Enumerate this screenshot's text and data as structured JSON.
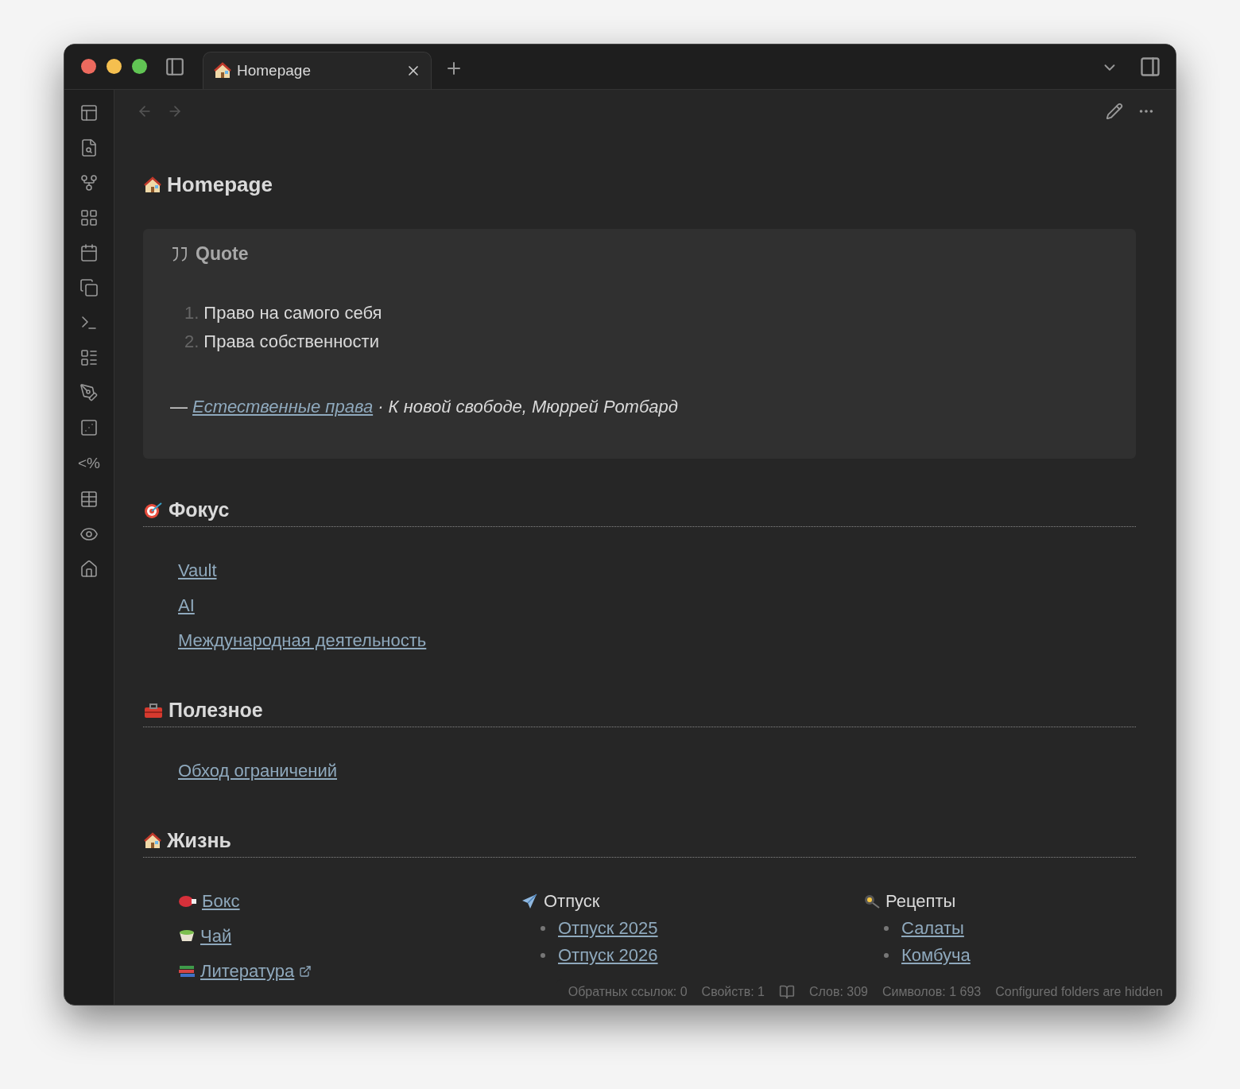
{
  "window": {
    "tabs": [
      {
        "label": "Homepage",
        "selected": true
      }
    ]
  },
  "ribbon": {
    "template_label": "<%"
  },
  "note": {
    "title": "Homepage",
    "callout": {
      "title": "Quote",
      "items": [
        {
          "number": "1.",
          "text": "Право на самого себя"
        },
        {
          "number": "2.",
          "text": "Права собственности"
        }
      ],
      "attribution": {
        "dash": "—",
        "link": "Естественные права",
        "rest": "· К новой свободе, Мюррей Ротбард"
      }
    },
    "sections": [
      {
        "kind": "links",
        "heading": "Фокус",
        "links": [
          {
            "text": "Vault",
            "external": false
          },
          {
            "text": "AI",
            "external": false
          },
          {
            "text": "Международная деятельность",
            "external": false
          }
        ]
      },
      {
        "kind": "links",
        "heading": "Полезное",
        "links": [
          {
            "text": "Обход ограничений",
            "external": false
          }
        ]
      },
      {
        "kind": "columns",
        "heading": "Жизнь",
        "columns": [
          {
            "kind": "links",
            "links": [
              {
                "text": "Бокс",
                "external": false
              },
              {
                "text": "Чай",
                "external": false
              },
              {
                "text": "Литература",
                "external": true
              }
            ]
          },
          {
            "kind": "group",
            "title": "Отпуск",
            "links": [
              {
                "text": "Отпуск 2025",
                "external": false
              },
              {
                "text": "Отпуск 2026",
                "external": false
              }
            ]
          },
          {
            "kind": "group",
            "title": "Рецепты",
            "links": [
              {
                "text": "Салаты",
                "external": false
              },
              {
                "text": "Комбуча",
                "external": false
              }
            ]
          }
        ]
      }
    ]
  },
  "status_bar": {
    "backlinks": "Обратных ссылок: 0",
    "properties": "Свойств: 1",
    "words": "Слов: 309",
    "characters": "Символов: 1 693",
    "notice": "Configured folders are hidden"
  }
}
